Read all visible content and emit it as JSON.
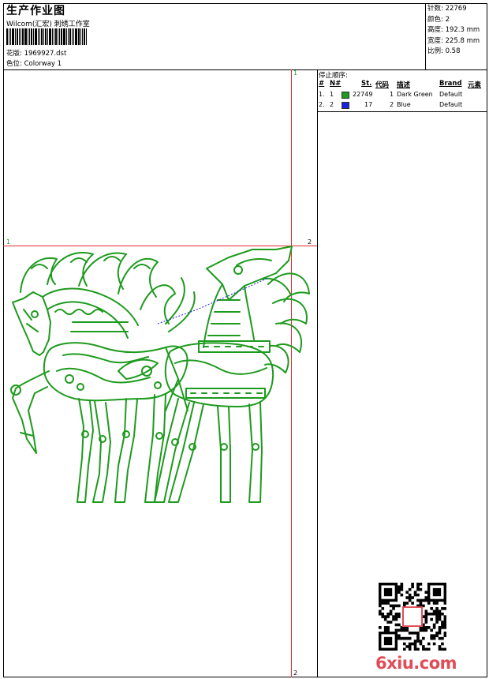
{
  "header": {
    "title": "生产作业图",
    "company": "Wilcom(汇宏) 刺绣工作室",
    "design_label": "花版: 1969927.dst",
    "color_label": "色位: Colorway 1"
  },
  "info": {
    "stitches": "针数: 22769",
    "colors": "颜色: 2",
    "height": "高度: 192.3 mm",
    "width": "宽度: 225.8 mm",
    "scale": "比例: 0.58"
  },
  "stops": {
    "title": "停止顺序:",
    "headers": {
      "num": "#",
      "n": "N#",
      "st": "St.",
      "code": "代码",
      "desc": "描述",
      "brand": "Brand",
      "elem": "元素"
    },
    "rows": [
      {
        "num": "1.",
        "n": "1",
        "color": "#1e9a1e",
        "st": "22749",
        "code": "1",
        "desc": "Dark Green",
        "brand": "Default"
      },
      {
        "num": "2.",
        "n": "2",
        "color": "#1a22e0",
        "st": "17",
        "code": "2",
        "desc": "Blue",
        "brand": "Default"
      }
    ]
  },
  "markers": {
    "top": "1",
    "bottom": "2",
    "left": "1",
    "right": "2"
  },
  "watermark": "6xiu.com",
  "colors": {
    "stitch_green": "#1e9a1e",
    "jump_blue": "#1a22e0",
    "guide_red": "#e03030",
    "watermark_red": "#e04b56"
  }
}
